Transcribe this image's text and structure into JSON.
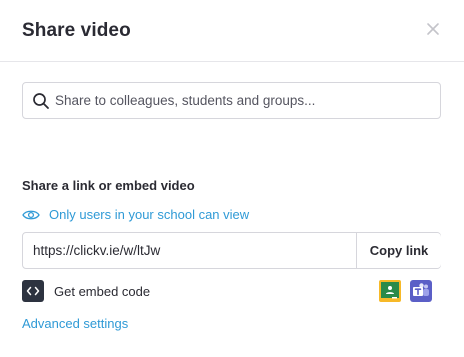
{
  "dialog": {
    "title": "Share video",
    "close_icon": "close-icon"
  },
  "search": {
    "placeholder": "Share to colleagues, students and groups...",
    "value": "",
    "icon": "search-icon"
  },
  "share_link": {
    "heading": "Share a link or embed video",
    "visibility_text": "Only users in your school can view",
    "visibility_icon": "eye-icon",
    "url": "https://clickv.ie/w/ltJw",
    "copy_label": "Copy link"
  },
  "embed": {
    "label": "Get embed code",
    "icon": "code-icon"
  },
  "integrations": {
    "google_classroom_icon": "google-classroom-icon",
    "teams_icon": "microsoft-teams-icon"
  },
  "advanced": {
    "label": "Advanced settings"
  },
  "colors": {
    "accent": "#2f9ad6",
    "text": "#2b2b33",
    "border": "#d6d6dc",
    "classroom_yellow": "#f7b928",
    "classroom_green": "#2a8a4a",
    "teams_purple": "#5b5fc7"
  }
}
